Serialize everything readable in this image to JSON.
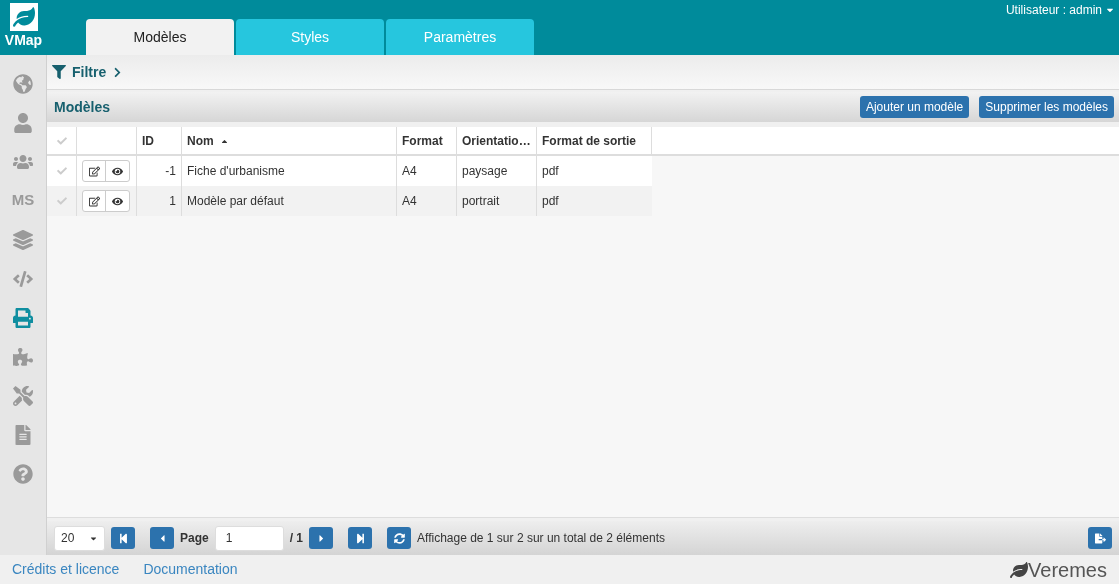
{
  "header": {
    "logo": "VMap",
    "user_menu": "Utilisateur : admin"
  },
  "tabs": [
    {
      "label": "Modèles",
      "selected": true
    },
    {
      "label": "Styles",
      "selected": false
    },
    {
      "label": "Paramètres",
      "selected": false
    }
  ],
  "sidebar": {
    "items": [
      {
        "kind": "icon",
        "selected": false
      },
      {
        "kind": "icon",
        "selected": false
      },
      {
        "kind": "icon",
        "selected": false
      },
      {
        "kind": "text",
        "label": "MS",
        "selected": false
      },
      {
        "kind": "icon",
        "selected": false
      },
      {
        "kind": "icon",
        "selected": false
      },
      {
        "kind": "icon",
        "selected": true
      },
      {
        "kind": "icon",
        "selected": false
      },
      {
        "kind": "icon",
        "selected": false
      },
      {
        "kind": "icon",
        "selected": false
      },
      {
        "kind": "icon",
        "selected": false
      }
    ]
  },
  "filter": {
    "label": "Filtre"
  },
  "panel": {
    "title": "Modèles",
    "buttons": [
      "Ajouter un modèle",
      "Supprimer les modèles"
    ]
  },
  "table": {
    "columns": [
      {
        "label": "ID",
        "sorted": false
      },
      {
        "label": "Nom",
        "sorted": true
      },
      {
        "label": "Format",
        "sorted": false
      },
      {
        "label": "Orientatio…",
        "sorted": false
      },
      {
        "label": "Format de sortie",
        "sorted": false
      }
    ],
    "rows": [
      {
        "checked": false,
        "cells": [
          "-1",
          "Fiche d'urbanisme",
          "A4",
          "paysage",
          "pdf"
        ]
      },
      {
        "checked": false,
        "cells": [
          "1",
          "Modèle par défaut",
          "A4",
          "portrait",
          "pdf"
        ]
      }
    ]
  },
  "pager": {
    "page_size": "20",
    "page_label": "Page",
    "page": "1",
    "page_total": "/ 1",
    "info": "Affichage de 1 sur 2 sur un total de 2 éléments"
  },
  "footer": {
    "links": [
      "Crédits et licence",
      "Documentation"
    ],
    "brand": "Veremes"
  }
}
